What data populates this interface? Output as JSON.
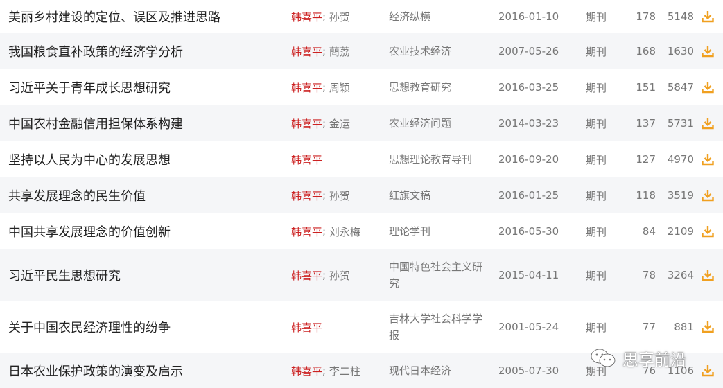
{
  "colors": {
    "primary_author": "#cc2222",
    "meta_text": "#777777",
    "title_text": "#222222",
    "row_alt_bg": "#f5f6f8",
    "download_icon": "#f0a020"
  },
  "download_icon_name": "download-icon",
  "rows": [
    {
      "title": "美丽乡村建设的定位、误区及推进思路",
      "author_main": "韩喜平",
      "author_sep": "; ",
      "author_others": "孙贺",
      "source": "经济纵横",
      "date": "2016-01-10",
      "type": "期刊",
      "cited": "178",
      "downloads": "5148"
    },
    {
      "title": "我国粮食直补政策的经济学分析",
      "author_main": "韩喜平",
      "author_sep": "; ",
      "author_others": "蔄荔",
      "source": "农业技术经济",
      "date": "2007-05-26",
      "type": "期刊",
      "cited": "168",
      "downloads": "1630"
    },
    {
      "title": "习近平关于青年成长思想研究",
      "author_main": "韩喜平",
      "author_sep": "; ",
      "author_others": "周颖",
      "source": "思想教育研究",
      "date": "2016-03-25",
      "type": "期刊",
      "cited": "151",
      "downloads": "5847"
    },
    {
      "title": "中国农村金融信用担保体系构建",
      "author_main": "韩喜平",
      "author_sep": "; ",
      "author_others": "金运",
      "source": "农业经济问题",
      "date": "2014-03-23",
      "type": "期刊",
      "cited": "137",
      "downloads": "5731"
    },
    {
      "title": "坚持以人民为中心的发展思想",
      "author_main": "韩喜平",
      "author_sep": "",
      "author_others": "",
      "source": "思想理论教育导刊",
      "date": "2016-09-20",
      "type": "期刊",
      "cited": "127",
      "downloads": "4970"
    },
    {
      "title": "共享发展理念的民生价值",
      "author_main": "韩喜平",
      "author_sep": "; ",
      "author_others": "孙贺",
      "source": "红旗文稿",
      "date": "2016-01-25",
      "type": "期刊",
      "cited": "118",
      "downloads": "3519"
    },
    {
      "title": "中国共享发展理念的价值创新",
      "author_main": "韩喜平",
      "author_sep": "; ",
      "author_others": "刘永梅",
      "source": "理论学刊",
      "date": "2016-05-30",
      "type": "期刊",
      "cited": "84",
      "downloads": "2109"
    },
    {
      "title": "习近平民生思想研究",
      "author_main": "韩喜平",
      "author_sep": "; ",
      "author_others": "孙贺",
      "source": "中国特色社会主义研究",
      "date": "2015-04-11",
      "type": "期刊",
      "cited": "78",
      "downloads": "3264"
    },
    {
      "title": "关于中国农民经济理性的纷争",
      "author_main": "韩喜平",
      "author_sep": "",
      "author_others": "",
      "source": "吉林大学社会科学学报",
      "date": "2001-05-24",
      "type": "期刊",
      "cited": "77",
      "downloads": "881"
    },
    {
      "title": "日本农业保护政策的演变及启示",
      "author_main": "韩喜平",
      "author_sep": "; ",
      "author_others": "李二柱",
      "source": "现代日本经济",
      "date": "2005-07-30",
      "type": "期刊",
      "cited": "76",
      "downloads": "1106"
    }
  ],
  "watermark": {
    "text": "思享前沿",
    "icon": "wechat-icon"
  }
}
